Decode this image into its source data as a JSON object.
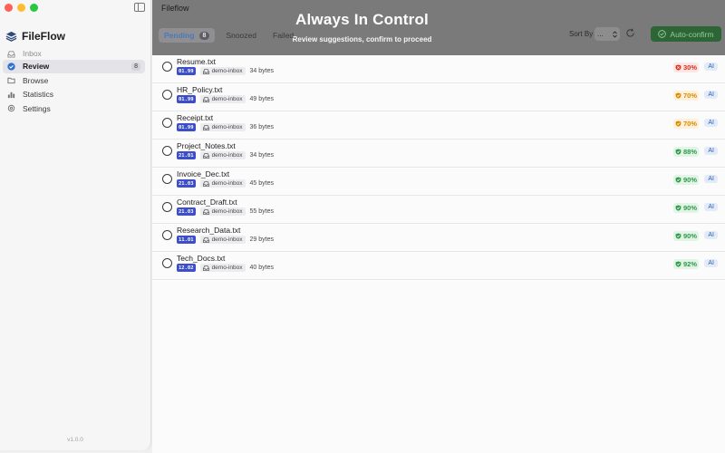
{
  "app": {
    "title": "Fileflow",
    "brand_name": "FileFlow",
    "version": "v1.0.0"
  },
  "banner": {
    "title": "Always In Control",
    "subtitle": "Review suggestions, confirm to proceed"
  },
  "sidebar": {
    "items": [
      {
        "label": "Inbox",
        "icon": "inbox-icon"
      },
      {
        "label": "Review",
        "icon": "check-circle-icon",
        "badge": "8",
        "active": true
      },
      {
        "label": "Browse",
        "icon": "folder-icon"
      },
      {
        "label": "Statistics",
        "icon": "bar-chart-icon"
      },
      {
        "label": "Settings",
        "icon": "gear-icon"
      }
    ]
  },
  "tabs": [
    {
      "label": "Pending",
      "count": "8",
      "active": true
    },
    {
      "label": "Snoozed"
    },
    {
      "label": "Failed"
    }
  ],
  "toolbar": {
    "sort_label": "Sort By",
    "sort_value": "...",
    "auto_confirm_label": "Auto-confirm"
  },
  "files": [
    {
      "name": "Resume.txt",
      "code": "01.99",
      "source": "demo-inbox",
      "size": "34 bytes",
      "confidence": "30%",
      "level": "low",
      "ai": "AI"
    },
    {
      "name": "HR_Policy.txt",
      "code": "01.99",
      "source": "demo-inbox",
      "size": "49 bytes",
      "confidence": "70%",
      "level": "mid",
      "ai": "AI"
    },
    {
      "name": "Receipt.txt",
      "code": "01.99",
      "source": "demo-inbox",
      "size": "36 bytes",
      "confidence": "70%",
      "level": "mid",
      "ai": "AI"
    },
    {
      "name": "Project_Notes.txt",
      "code": "21.01",
      "source": "demo-inbox",
      "size": "34 bytes",
      "confidence": "88%",
      "level": "high",
      "ai": "AI"
    },
    {
      "name": "Invoice_Dec.txt",
      "code": "21.03",
      "source": "demo-inbox",
      "size": "45 bytes",
      "confidence": "90%",
      "level": "high",
      "ai": "AI"
    },
    {
      "name": "Contract_Draft.txt",
      "code": "21.03",
      "source": "demo-inbox",
      "size": "55 bytes",
      "confidence": "90%",
      "level": "high",
      "ai": "AI"
    },
    {
      "name": "Research_Data.txt",
      "code": "11.01",
      "source": "demo-inbox",
      "size": "29 bytes",
      "confidence": "90%",
      "level": "high",
      "ai": "AI"
    },
    {
      "name": "Tech_Docs.txt",
      "code": "12.02",
      "source": "demo-inbox",
      "size": "40 bytes",
      "confidence": "92%",
      "level": "high",
      "ai": "AI"
    }
  ],
  "colors": {
    "accent": "#2c6fd1",
    "auto_confirm_bg": "#2e6536",
    "code_tag": "#3c4fc9",
    "conf_low": "#d92d20",
    "conf_mid": "#d98a00",
    "conf_high": "#2e9a4a"
  }
}
